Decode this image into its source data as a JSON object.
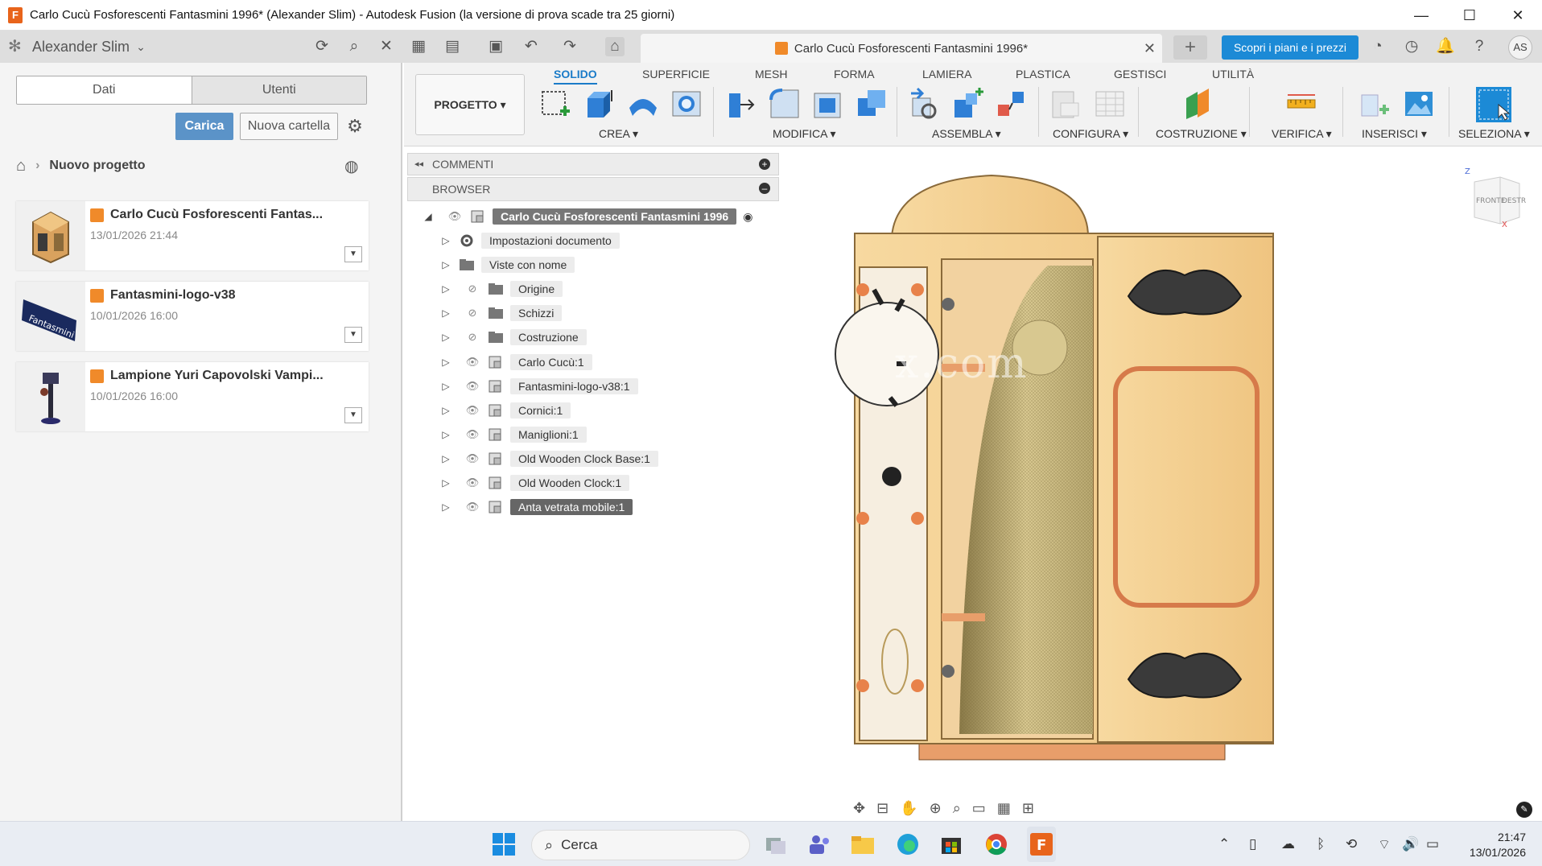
{
  "window": {
    "title": "Carlo Cucù Fosforescenti Fantasmini 1996* (Alexander Slim) - Autodesk Fusion (la versione di prova scade tra 25 giorni)",
    "app_icon_letter": "F",
    "minimize": "—",
    "maximize": "☐",
    "close": "✕"
  },
  "top": {
    "user_name": "Alexander Slim",
    "doc_tab_title": "Carlo Cucù Fosforescenti Fantasmini 1996*",
    "promo_button": "Scopri i piani e i prezzi",
    "avatar_initials": "AS"
  },
  "left_panel": {
    "tabs": [
      "Dati",
      "Utenti"
    ],
    "upload_button": "Carica",
    "new_folder_button": "Nuova cartella",
    "breadcrumb": "Nuovo progetto",
    "files": [
      {
        "name": "Carlo Cucù Fosforescenti Fantas...",
        "date": "13/01/2026 21:44"
      },
      {
        "name": "Fantasmini-logo-v38",
        "date": "10/01/2026 16:00"
      },
      {
        "name": "Lampione Yuri Capovolski Vampi...",
        "date": "10/01/2026 16:00"
      }
    ]
  },
  "ribbon": {
    "project_button": "PROGETTO ▾",
    "tabs": [
      "SOLIDO",
      "SUPERFICIE",
      "MESH",
      "FORMA",
      "LAMIERA",
      "PLASTICA",
      "GESTISCI",
      "UTILITÀ"
    ],
    "active_tab": "SOLIDO",
    "groups": [
      "CREA ▾",
      "MODIFICA ▾",
      "ASSEMBLA ▾",
      "CONFIGURA ▾",
      "COSTRUZIONE ▾",
      "VERIFICA ▾",
      "INSERISCI ▾",
      "SELEZIONA ▾"
    ]
  },
  "browser": {
    "comments_label": "COMMENTI",
    "browser_label": "BROWSER",
    "root": "Carlo Cucù Fosforescenti Fantasmini 1996",
    "items": [
      "Impostazioni documento",
      "Viste con nome",
      "Origine",
      "Schizzi",
      "Costruzione",
      "Carlo Cucù:1",
      "Fantasmini-logo-v38:1",
      "Cornici:1",
      "Maniglioni:1",
      "Old Wooden Clock Base:1",
      "Old Wooden Clock:1",
      "Anta vetrata mobile:1"
    ],
    "selected_item": "Anta vetrata mobile:1"
  },
  "viewcube": {
    "front": "FRONTE",
    "right": "DESTRA",
    "axis_z": "Z",
    "axis_x": "X"
  },
  "watermark": "x.com",
  "taskbar": {
    "search_placeholder": "Cerca",
    "time": "21:47",
    "date": "13/01/2026"
  },
  "colors": {
    "accent_blue": "#1c8ad6",
    "fusion_orange": "#e8641b",
    "wood_light": "#f4cf8f",
    "wood_dark": "#d9a25e"
  }
}
